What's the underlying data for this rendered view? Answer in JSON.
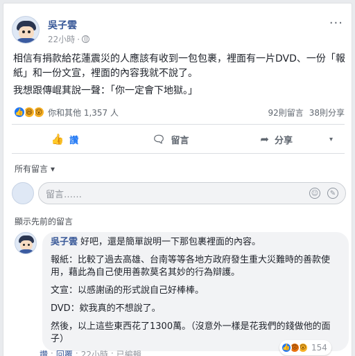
{
  "post": {
    "author": "吳子雲",
    "time": "22小時",
    "dot": "·",
    "paragraphs": [
      "相信有捐款給花蓮震災的人應該有收到一包包裹，裡面有一片DVD、一份「報紙」和一份文宣，裡面的內容我就不說了。",
      "我想跟傳崐萁說一聲：「你一定會下地獄。」"
    ],
    "reactions_text": "你和其他 1,357 人",
    "comments_count": "92則留言",
    "shares_count": "38則分享"
  },
  "actions": {
    "like": "讚",
    "comment": "留言",
    "share": "分享"
  },
  "comments_section": {
    "sort_label": "所有留言",
    "input_placeholder": "留言……",
    "previous_label": "顯示先前的留言"
  },
  "comment": {
    "author": "吳子雲",
    "paragraphs": [
      "好吧，還是簡單說明一下那包裹裡面的內容。",
      "報紙：比較了過去高雄、台南等等各地方政府發生重大災難時的善款使用，藉此為自己使用善款莫名其妙的行為辯護。",
      "文宣：以感謝函的形式說自己好棒棒。",
      "DVD：欸我真的不想說了。",
      "然後，以上這些東西花了1300萬。（沒意外一樣是花我們的錢做他的面子）"
    ],
    "like": "讚",
    "reply": "回覆",
    "time": "22小時",
    "edited": "已編輯",
    "reaction_count": "154"
  },
  "icons": {
    "like": "thumbs-up-icon",
    "comment": "speech-bubble-icon",
    "share": "share-arrow-icon",
    "globe": "globe-icon",
    "emoji": "emoji-icon",
    "sticker": "sticker-icon"
  },
  "colors": {
    "link": "#385898",
    "like_blue": "#2078f4",
    "meta_gray": "#90949c"
  }
}
